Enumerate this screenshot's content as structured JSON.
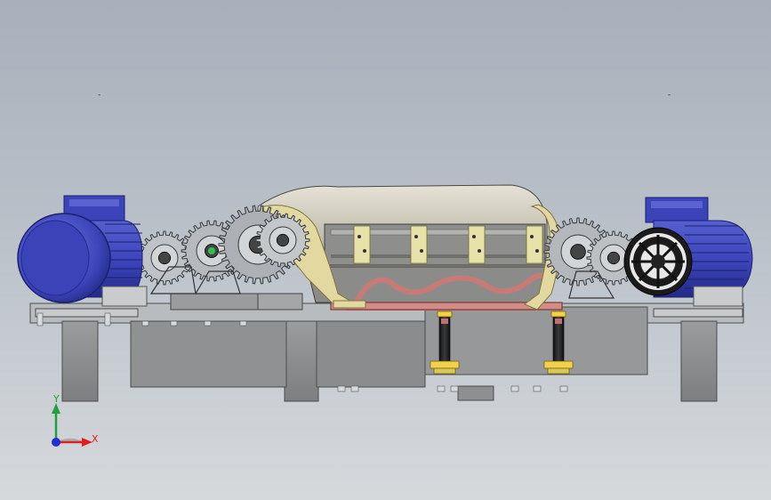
{
  "viewport": {
    "left_marker": "-",
    "right_marker": "-"
  },
  "triad": {
    "x_label": "X",
    "y_label": "Y"
  },
  "colors": {
    "background_top": "#a7b0bb",
    "background_bottom": "#d6d9dc",
    "motor_blue": "#3a44b8",
    "frame_gray": "#8d8f91",
    "gear_gray": "#b8bcc0",
    "drum_beige": "#cfcbbd",
    "bracket_yellow": "#e2d8a0",
    "cradle_red": "#c97a76",
    "x_axis": "#e02020",
    "y_axis": "#20a040",
    "z_axis": "#2030d0"
  },
  "icons": [
    "coordinate-triad-icon"
  ]
}
